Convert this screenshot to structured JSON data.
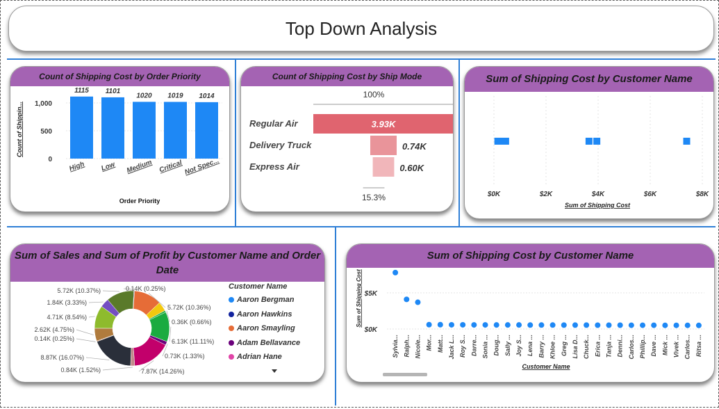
{
  "dashboard": {
    "title": "Top Down Analysis"
  },
  "colors": {
    "header": "#a463b3",
    "bar": "#1e88f5",
    "funnel": "#e0646f",
    "divider": "#2f7fd6"
  },
  "priority_chart": {
    "title": "Count of Shipping Cost by Order Priority",
    "ylabel": "Count of Shippin...",
    "xlabel": "Order Priority",
    "yticks": [
      "1,000",
      "500",
      "0"
    ],
    "ylim": [
      0,
      1200
    ],
    "categories": [
      "High",
      "Low",
      "Medium",
      "Critical",
      "Not Spec..."
    ],
    "values": [
      1115,
      1101,
      1020,
      1019,
      1014
    ],
    "labels": [
      "1115",
      "1101",
      "1020",
      "1019",
      "1014"
    ]
  },
  "funnel_chart": {
    "title": "Count of Shipping Cost by Ship Mode",
    "top_pct": "100%",
    "bottom_pct": "15.3%",
    "categories": [
      "Regular Air",
      "Delivery Truck",
      "Express Air"
    ],
    "values": [
      3930,
      740,
      600
    ],
    "labels": [
      "3.93K",
      "0.74K",
      "0.60K"
    ]
  },
  "scatter_small": {
    "title": "Sum of Shipping Cost by Customer Name",
    "xlabel": "Sum of Shipping Cost",
    "xticks": [
      "$0K",
      "$2K",
      "$4K",
      "$6K",
      "$8K"
    ],
    "xlim": [
      0,
      8000
    ],
    "points": [
      150,
      300,
      450,
      3650,
      3950,
      7400
    ]
  },
  "donut_chart": {
    "title": "Sum of Sales and Sum of Profit by Customer Name and Order Date",
    "legend_title": "Customer Name",
    "legend": [
      {
        "name": "Aaron Bergman",
        "color": "#1e88f5"
      },
      {
        "name": "Aaron Hawkins",
        "color": "#12239e"
      },
      {
        "name": "Aaron Smayling",
        "color": "#e66c37"
      },
      {
        "name": "Adam Bellavance",
        "color": "#6b007b"
      },
      {
        "name": "Adrian Hane",
        "color": "#e044a7"
      }
    ],
    "slices": [
      {
        "label": "0.14K (0.25%)",
        "value": 0.25,
        "color": "#12239e"
      },
      {
        "label": "5.72K (10.36%)",
        "value": 10.36,
        "color": "#e66c37"
      },
      {
        "label": "",
        "value": 3.5,
        "color": "#f2c80f"
      },
      {
        "label": "0.36K (0.66%)",
        "value": 0.66,
        "color": "#1aab40"
      },
      {
        "label": "6.13K (11.11%)",
        "value": 11.11,
        "color": "#1aab40"
      },
      {
        "label": "0.73K (1.33%)",
        "value": 1.33,
        "color": "#6b007b"
      },
      {
        "label": "7.87K (14.26%)",
        "value": 14.26,
        "color": "#c2006b"
      },
      {
        "label": "0.84K (1.52%)",
        "value": 1.52,
        "color": "#c08a8a"
      },
      {
        "label": "8.87K (16.07%)",
        "value": 16.07,
        "color": "#2a2f3a"
      },
      {
        "label": "0.14K (0.25%)",
        "value": 0.25,
        "color": "#a0522d"
      },
      {
        "label": "2.62K (4.75%)",
        "value": 4.75,
        "color": "#b07b3d"
      },
      {
        "label": "4.71K (8.54%)",
        "value": 8.54,
        "color": "#8ebb2d"
      },
      {
        "label": "1.84K (3.33%)",
        "value": 3.33,
        "color": "#744ec2"
      },
      {
        "label": "5.72K (10.37%)",
        "value": 10.37,
        "color": "#5a7a2a"
      }
    ]
  },
  "scatter_large": {
    "title": "Sum of Shipping Cost by Customer Name",
    "ylabel": "Sum of Shipping Cost",
    "xlabel": "Customer Name",
    "yticks": [
      "$5K",
      "$0K"
    ],
    "ylim": [
      0,
      10000
    ],
    "categories": [
      "Sylvia...",
      "Ralph...",
      "Nicole...",
      "Mor...",
      "Matt...",
      "Jack L...",
      "Roy S...",
      "Darre...",
      "Sonia ...",
      "Doug...",
      "Sally ...",
      "Joy S...",
      "Lena ...",
      "Barry ...",
      "Khloe ...",
      "Greg ...",
      "Lisa D...",
      "Chuck...",
      "Erica ...",
      "Tanja ...",
      "Denni...",
      "Carlos...",
      "Phillip...",
      "Dave ...",
      "Mick ...",
      "Vivek ...",
      "Carlos...",
      "Ritsa ..."
    ],
    "values": [
      7800,
      4100,
      3700,
      600,
      600,
      580,
      580,
      570,
      570,
      560,
      560,
      560,
      550,
      550,
      550,
      540,
      540,
      540,
      530,
      530,
      530,
      520,
      520,
      520,
      510,
      510,
      510,
      500
    ]
  }
}
